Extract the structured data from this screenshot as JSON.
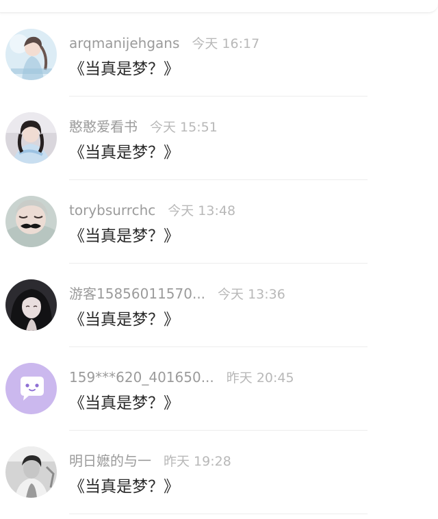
{
  "comments": [
    {
      "name": "arqmanijehgans",
      "time": "今天 16:17",
      "text": "《当真是梦？》",
      "avatar": "photo-girl-light-icon"
    },
    {
      "name": "憨憨爱看书",
      "time": "今天 15:51",
      "text": "《当真是梦？》",
      "avatar": "photo-girl-hanfu-icon"
    },
    {
      "name": "torybsurrchc",
      "time": "今天 13:48",
      "text": "《当真是梦？》",
      "avatar": "photo-mustache-mask-icon"
    },
    {
      "name": "游客15856011570...",
      "time": "今天 13:36",
      "text": "《当真是梦？》",
      "avatar": "photo-anime-girl-icon"
    },
    {
      "name": "159***620_401650...",
      "time": "昨天 20:45",
      "text": "《当真是梦？》",
      "avatar": "default-chat-bubble-icon"
    },
    {
      "name": "明日嬷的与一",
      "time": "昨天 19:28",
      "text": "《当真是梦？》",
      "avatar": "photo-bw-boy-icon"
    }
  ],
  "colors": {
    "default_avatar_bg": "#cbb8ee",
    "name": "#9b9b9b",
    "time": "#b8b8b8",
    "text": "#2a2a2a"
  }
}
